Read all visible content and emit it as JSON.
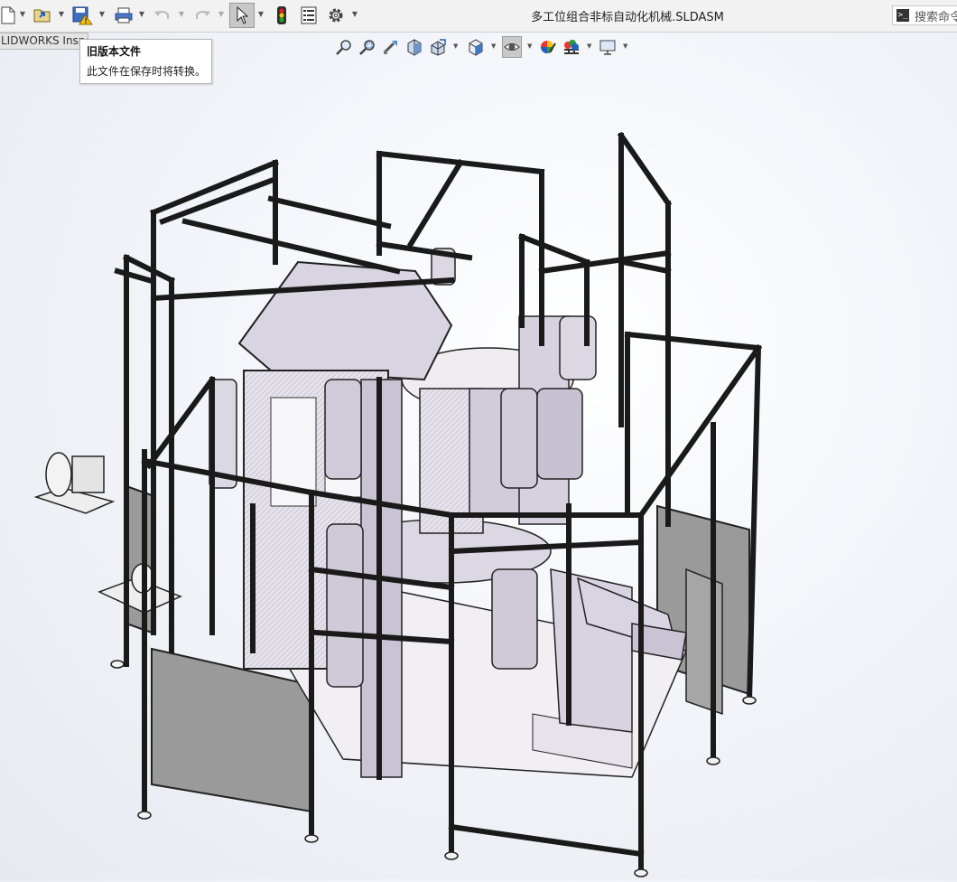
{
  "window": {
    "title": "多工位组合非标自动化机械.SLDASM",
    "search_placeholder": "搜索命令"
  },
  "toolbar": {
    "buttons": [
      {
        "name": "new-document-icon"
      },
      {
        "name": "open-icon"
      },
      {
        "name": "save-icon"
      },
      {
        "name": "print-icon"
      },
      {
        "name": "undo-icon"
      },
      {
        "name": "redo-icon"
      },
      {
        "name": "select-icon"
      },
      {
        "name": "rebuild-icon"
      },
      {
        "name": "file-properties-icon"
      },
      {
        "name": "options-gear-icon"
      }
    ]
  },
  "document_tab": {
    "label": "LIDWORKS Inspect"
  },
  "tooltip": {
    "title": "旧版本文件",
    "body": "此文件在保存时将转换。"
  },
  "view_toolbar": {
    "buttons": [
      {
        "name": "zoom-to-fit-icon"
      },
      {
        "name": "zoom-to-area-icon"
      },
      {
        "name": "previous-view-icon"
      },
      {
        "name": "section-view-icon"
      },
      {
        "name": "dynamic-annotation-icon"
      },
      {
        "name": "view-orientation-icon"
      },
      {
        "name": "display-style-icon"
      },
      {
        "name": "hide-show-items-icon"
      },
      {
        "name": "edit-appearance-icon"
      },
      {
        "name": "apply-scene-icon"
      },
      {
        "name": "view-settings-icon"
      }
    ]
  },
  "model": {
    "description_name": "assembly-3d-model",
    "frame_color": "#1a1a1a",
    "panel_color": "#9a9a9a",
    "part_color": "#e4e1ea"
  }
}
